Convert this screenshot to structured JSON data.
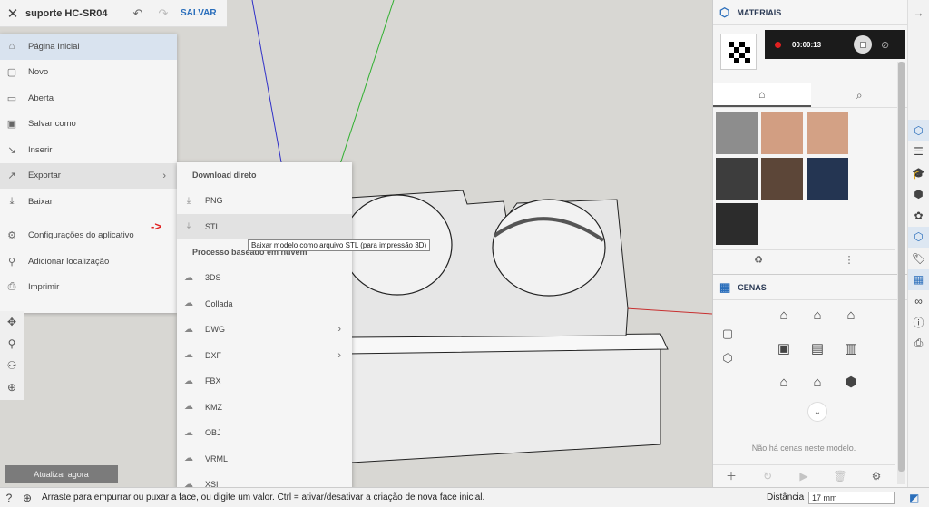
{
  "topbar": {
    "close_icon": "close-icon",
    "title": "suporte HC-SR04",
    "save_label": "SALVAR"
  },
  "menu": {
    "items": [
      {
        "label": "Página Inicial",
        "icon": "home-icon"
      },
      {
        "label": "Novo",
        "icon": "new-file-icon"
      },
      {
        "label": "Aberta",
        "icon": "folder-icon"
      },
      {
        "label": "Salvar como",
        "icon": "save-as-icon"
      },
      {
        "label": "Inserir",
        "icon": "insert-icon"
      },
      {
        "label": "Exportar",
        "icon": "export-icon"
      },
      {
        "label": "Baixar",
        "icon": "download-icon"
      },
      {
        "label": "Configurações do aplicativo",
        "icon": "gear-icon"
      },
      {
        "label": "Adicionar localização",
        "icon": "location-pin-icon"
      },
      {
        "label": "Imprimir",
        "icon": "printer-icon"
      }
    ]
  },
  "submenu": {
    "direct_header": "Download direto",
    "direct_items": [
      {
        "label": "PNG"
      },
      {
        "label": "STL"
      }
    ],
    "cloud_header": "Processo baseado em nuvem",
    "cloud_items": [
      {
        "label": "3DS"
      },
      {
        "label": "Collada"
      },
      {
        "label": "DWG"
      },
      {
        "label": "DXF"
      },
      {
        "label": "FBX"
      },
      {
        "label": "KMZ"
      },
      {
        "label": "OBJ"
      },
      {
        "label": "VRML"
      },
      {
        "label": "XSI"
      }
    ]
  },
  "tooltip": "Baixar modelo como arquivo STL (para impressão 3D)",
  "annotation_arrow": "->",
  "update_button": "Atualizar agora",
  "statusbar": {
    "message": "Arraste para empurrar ou puxar a face, ou digite um valor. Ctrl = ativar/desativar a criação de nova face inicial.",
    "distance_label": "Distância",
    "distance_value": "17 mm"
  },
  "materials": {
    "title": "MATERIAIS",
    "recorder_time": "00:00:13",
    "swatch_colors": [
      "#8d8d8d",
      "#d29e82",
      "#d3a185",
      "#3d3d3d",
      "#5c4638",
      "#243552",
      "#2c2c2c"
    ]
  },
  "scenes": {
    "title": "CENAS",
    "empty_text": "Não há cenas neste modelo."
  },
  "accent_color": "#2a6ebb"
}
